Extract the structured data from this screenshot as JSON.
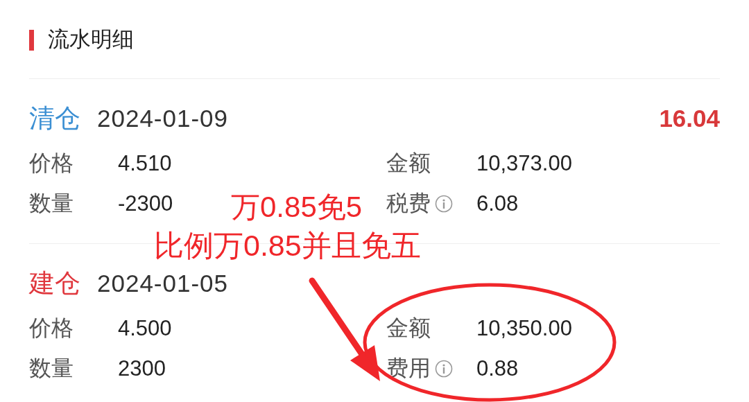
{
  "section": {
    "title": "流水明细"
  },
  "records": [
    {
      "kind": "close",
      "type": "清仓",
      "date": "2024-01-09",
      "profit": "16.04",
      "fields": [
        {
          "label": "价格",
          "value": "4.510"
        },
        {
          "label": "金额",
          "value": "10,373.00"
        },
        {
          "label": "数量",
          "value": "-2300"
        },
        {
          "label": "税费",
          "value": "6.08",
          "info": true
        }
      ]
    },
    {
      "kind": "open",
      "type": "建仓",
      "date": "2024-01-05",
      "fields": [
        {
          "label": "价格",
          "value": "4.500"
        },
        {
          "label": "金额",
          "value": "10,350.00"
        },
        {
          "label": "数量",
          "value": "2300"
        },
        {
          "label": "费用",
          "value": "0.88",
          "info": true
        }
      ]
    }
  ],
  "annotations": {
    "lines": [
      "万0.85免5",
      "比例万0.85并且免五"
    ]
  }
}
